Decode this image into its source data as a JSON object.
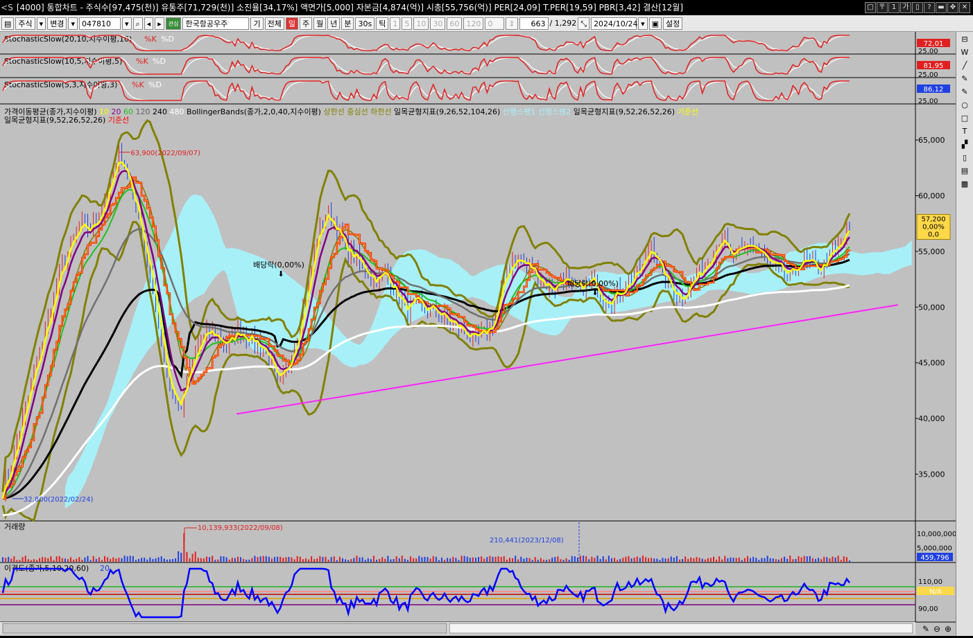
{
  "window": {
    "code": "[4000]",
    "title": "통합차트 - 주식수[97,475(천)] 유통주[71,729(천)] 소진율[34,17%] 액면가[5,000] 자본금[4,874(억)] 시총[55,756(억)] PER[24,09] T.PER[19,59] PBR[3,42] 결산[12월]"
  },
  "toolbar": {
    "market": "주식",
    "change": "변경",
    "stock_code": "047810",
    "stock_name": "한국항공우주",
    "view_labels": [
      "기",
      "전체"
    ],
    "period_tabs": [
      "일",
      "주",
      "월",
      "년",
      "분",
      "30s",
      "틱"
    ],
    "active_period": "일",
    "interval_buttons": [
      "1",
      "5",
      "10",
      "30",
      "60",
      "120"
    ],
    "offset_value": "0",
    "count_value": "663",
    "total_value": "/ 1,292",
    "date_value": "2024/10/24",
    "settings_label": "설정"
  },
  "colors": {
    "panel_bg": "#c0c0c0",
    "price_up": "#e02020",
    "price_down": "#2040e0",
    "ichimoku_cloud": "#a8f0f8",
    "bollinger": "#808000",
    "ma5": "#ffff00",
    "ma10": "#800080",
    "ma20": "#ffa500",
    "ma60": "#20c020",
    "ma120": "#808080",
    "ma240": "#000000",
    "ma480": "#ffffff",
    "trendline": "#ff20ff",
    "kijun": "#ff0000"
  },
  "chart_data": [
    {
      "type": "line",
      "panel": "stochastic-1",
      "title": "StochasticSlow(20,10,지수이평,10)",
      "legend": [
        "%K",
        "%D"
      ],
      "last_value": "72,01",
      "axis_label": "25,00",
      "ylim": [
        0,
        100
      ]
    },
    {
      "type": "line",
      "panel": "stochastic-2",
      "title": "StochasticSlow(10,5,지수이평,5)",
      "legend": [
        "%K",
        "%D"
      ],
      "last_value": "81,95",
      "axis_label": "25,00",
      "ylim": [
        0,
        100
      ]
    },
    {
      "type": "line",
      "panel": "stochastic-3",
      "title": "StochasticSlow(5,3,지수이평,3)",
      "legend": [
        "%K",
        "%D"
      ],
      "last_value": "86,12",
      "axis_label": "25,00",
      "ylim": [
        0,
        100
      ]
    },
    {
      "type": "line",
      "panel": "price",
      "legend_row1": [
        {
          "text": "가격이동평균(종가,지수이평)",
          "color": "#000000"
        },
        {
          "text": "10",
          "color": "#ffff00"
        },
        {
          "text": "20",
          "color": "#800080"
        },
        {
          "text": "60",
          "color": "#20c020"
        },
        {
          "text": "120",
          "color": "#606060"
        },
        {
          "text": "240",
          "color": "#000000"
        },
        {
          "text": "480",
          "color": "#ffffff"
        },
        {
          "text": "BollingerBands(종가,2,0,40,지수이평)",
          "color": "#000000"
        },
        {
          "text": "상한선",
          "color": "#808000"
        },
        {
          "text": "중심선",
          "color": "#808000"
        },
        {
          "text": "하한선",
          "color": "#808000"
        },
        {
          "text": "일목균형지표(9,26,52,104,26)",
          "color": "#000000"
        },
        {
          "text": "선행스팬1",
          "color": "#a8f0f8"
        },
        {
          "text": "선행스팬2",
          "color": "#a8f0f8"
        },
        {
          "text": "일목균형지표(9,52,26,52,26)",
          "color": "#000000"
        },
        {
          "text": "기준선",
          "color": "#ffff00"
        }
      ],
      "legend_row2": [
        {
          "text": "일목균형지표(9,52,26,52,26)",
          "color": "#000000"
        },
        {
          "text": "기준선",
          "color": "#ff0000"
        }
      ],
      "y_ticks": [
        "65,000",
        "60,000",
        "55,000",
        "50,000",
        "45,000",
        "40,000",
        "35,000"
      ],
      "y_tick_values": [
        65000,
        60000,
        55000,
        50000,
        45000,
        40000,
        35000
      ],
      "ylim": [
        30800,
        66500
      ],
      "current_price_box": [
        "57,200",
        "0,00%",
        "0,0"
      ],
      "current_price": 57200,
      "annotations": [
        {
          "text": "63,900(2022/09/07)",
          "kind": "high",
          "value": 63900
        },
        {
          "text": "32,800(2022/02/24)",
          "kind": "low",
          "value": 32800
        },
        {
          "text": "배당락(0,00%)",
          "kind": "dividend"
        },
        {
          "text": "배당락(0,00%)",
          "kind": "dividend"
        }
      ],
      "close_series": [
        33500,
        36200,
        39800,
        43500,
        46800,
        50200,
        53600,
        55800,
        57200,
        56900,
        58600,
        61200,
        63900,
        60800,
        57200,
        52600,
        47800,
        42500,
        40800,
        44200,
        46800,
        47900,
        47200,
        46600,
        48000,
        47300,
        46700,
        45800,
        42600,
        44800,
        47900,
        51800,
        56800,
        58600,
        56900,
        54800,
        54200,
        53200,
        52400,
        53100,
        51200,
        49600,
        50400,
        49700,
        49800,
        48900,
        48300,
        47800,
        46900,
        47600,
        48900,
        52800,
        54600,
        53900,
        53200,
        52100,
        51600,
        52800,
        51300,
        51900,
        52400,
        50800,
        50900,
        51700,
        52600,
        53600,
        55900,
        52800,
        51600,
        50800,
        52400,
        53200,
        54900,
        56500,
        54200,
        54900,
        55800,
        54900,
        53600,
        53300,
        52600,
        54200,
        53800,
        53300,
        54600,
        55400,
        57200
      ]
    },
    {
      "type": "bar",
      "panel": "volume",
      "title": "거래량",
      "y_ticks": [
        "10,000,000",
        "5,000,000"
      ],
      "y_tick_values": [
        10000000,
        5000000
      ],
      "ylim": [
        0,
        11000000
      ],
      "last_value_box": "459,796",
      "last_value": 459796,
      "annotations": [
        {
          "text": "10,139,933(2022/09/08)",
          "value": 10139933
        },
        {
          "text": "210,441(2023/12/08)",
          "value": 210441
        }
      ]
    },
    {
      "type": "line",
      "panel": "disparity",
      "title": "이격도(종가,5,10,20,60)",
      "legend_extra": "20",
      "y_ticks": [
        "110,00",
        "90,00"
      ],
      "y_tick_values": [
        110,
        90
      ],
      "ylim": [
        84,
        116
      ],
      "last_value_box": "N/A"
    }
  ],
  "right_tools": [
    "⊟",
    "W",
    "╱",
    "✎",
    "✎",
    "○",
    "□",
    "T",
    "▞",
    "▯",
    "▤",
    "▩"
  ]
}
